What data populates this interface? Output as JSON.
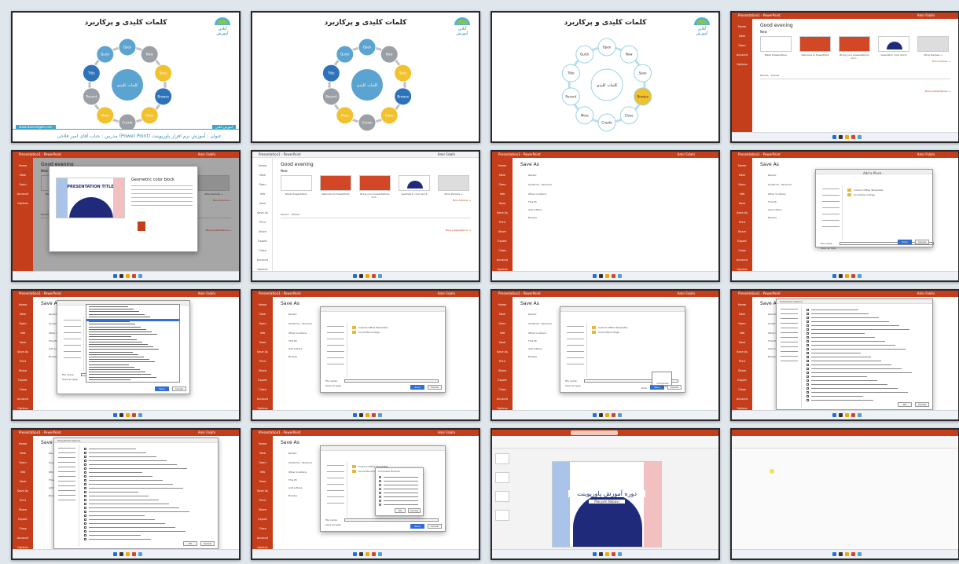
{
  "slide": {
    "title": "کلمات کلیدی و پرکاربرد",
    "center": "کلمات کلیدی",
    "logo_text": "آنلاین آموزش",
    "nodes": [
      "Open",
      "New",
      "Save",
      "Browse",
      "Close",
      "Create",
      "More",
      "Recent",
      "Title",
      "Quick"
    ],
    "footer_main": "عنوان : آموزش نرم افزار پاورپوینت (Power Point)  مدرس : جناب آقای امیر فلاحی",
    "footer_left": "www.daneshgah.com",
    "footer_right": "آموزش آنلاین"
  },
  "ppt": {
    "greeting": "Good evening",
    "new_label": "New",
    "recent_label": "Recent",
    "pinned_label": "Pinned",
    "save_as": "Save As",
    "add_place": "Add a Place",
    "blank": "Blank Presentation",
    "welcome": "Welcome to PowerPoint",
    "bring": "Bring your presentations to it...",
    "geometric": "Geometric color block",
    "more_themes": "More themes →",
    "more_presentations": "More presentations →",
    "side": [
      "Home",
      "New",
      "Open",
      "Info",
      "Save",
      "Save As",
      "Print",
      "Share",
      "Export",
      "Close",
      "Account",
      "Options"
    ],
    "options_title": "PowerPoint Options",
    "presentation_title": "PRESENTATION TITLE",
    "search": "Search",
    "user": "Amir Falahi",
    "app_title": "Presentation1 - PowerPoint",
    "onedrive": "OneDrive - Personal",
    "this_pc": "This PC",
    "browse": "Browse",
    "other_locations": "Other locations",
    "file_name": "File name:",
    "save_type": "Save as type:",
    "save_btn": "Save",
    "cancel_btn": "Cancel",
    "tools": "Tools",
    "ok_btn": "OK",
    "folder1": "Custom Office Templates",
    "folder2": "Sound Recordings",
    "compress": "Compress Pictures",
    "course_title": "دوره آموزش پاورپوینت",
    "course_sub": "Maryam Nabavi"
  }
}
